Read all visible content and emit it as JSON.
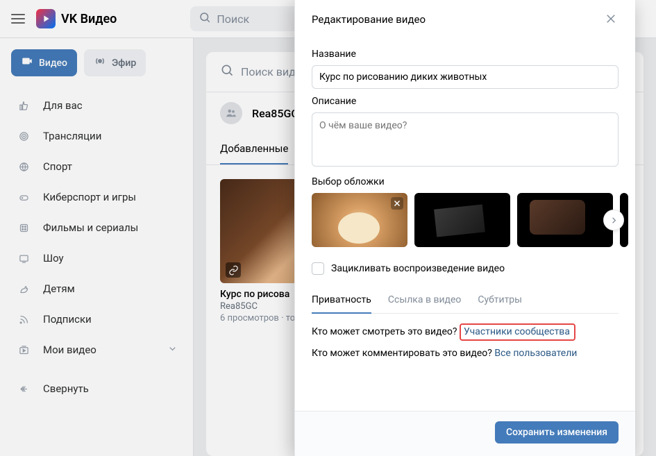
{
  "brand": {
    "name": "VK Видео"
  },
  "header_search": {
    "placeholder": "Поиск"
  },
  "sidebar": {
    "video_btn": "Видео",
    "live_btn": "Эфир",
    "items": [
      {
        "label": "Для вас"
      },
      {
        "label": "Трансляции"
      },
      {
        "label": "Спорт"
      },
      {
        "label": "Киберспорт и игры"
      },
      {
        "label": "Фильмы и сериалы"
      },
      {
        "label": "Шоу"
      },
      {
        "label": "Детям"
      },
      {
        "label": "Подписки"
      },
      {
        "label": "Мои видео"
      }
    ],
    "collapse": "Свернуть"
  },
  "main": {
    "search_placeholder": "Поиск виде",
    "group_name": "Rea85GC",
    "added_tab": "Добавленные",
    "card": {
      "title": "Курс по рисова",
      "author": "Rea85GC",
      "views": "6 просмотров · то"
    }
  },
  "modal": {
    "title": "Редактирование видео",
    "name_label": "Название",
    "name_value": "Курс по рисованию диких животных",
    "desc_label": "Описание",
    "desc_placeholder": "О чём ваше видео?",
    "cover_label": "Выбор обложки",
    "loop_label": "Зацикливать воспроизведение видео",
    "tabs": {
      "privacy": "Приватность",
      "link": "Ссылка в видео",
      "subs": "Субтитры"
    },
    "who_watch_q": "Кто может смотреть это видео?",
    "who_watch_a": "Участники сообщества",
    "who_comment_q": "Кто может комментировать это видео?",
    "who_comment_a": "Все пользователи",
    "save": "Сохранить изменения"
  }
}
